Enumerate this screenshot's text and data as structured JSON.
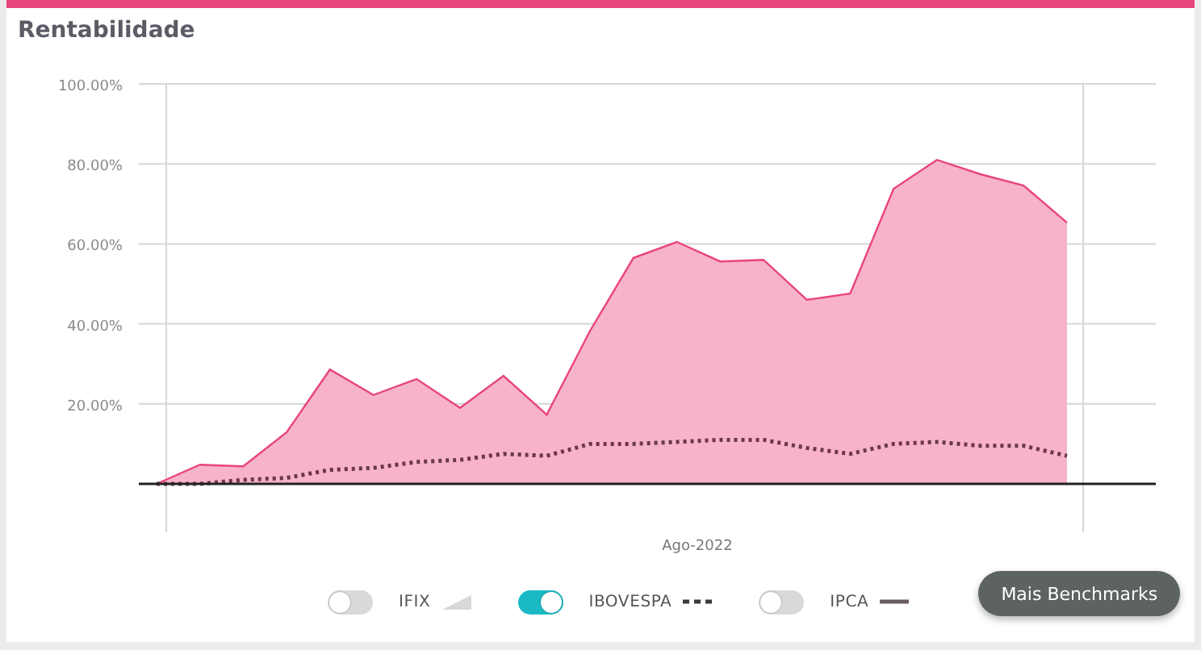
{
  "card": {
    "title": "Rentabilidade"
  },
  "chart": {
    "chart_data": {
      "type": "area",
      "categories": [
        null,
        null,
        null,
        null,
        null,
        null,
        null,
        null,
        null,
        null,
        null,
        null,
        null,
        null,
        null,
        null,
        null,
        null,
        null,
        null,
        null,
        null
      ],
      "series": [
        {
          "color": "#f7b3cb",
          "values": [
            0,
            4.8,
            4.4,
            12.9,
            28.6,
            22.2,
            26.2,
            19,
            27,
            17.3,
            38.3,
            56.5,
            60.5,
            55.6,
            56,
            46,
            47.6,
            73.8,
            81,
            77.4,
            74.6,
            65.3
          ]
        },
        {
          "type": "line",
          "line_style": "dotted",
          "color": "#6b3848",
          "values": [
            0,
            0,
            1,
            1.5,
            3.5,
            4,
            5.5,
            6,
            7.5,
            7,
            10,
            10,
            10.5,
            11,
            11,
            9,
            7.5,
            10,
            10.5,
            9.5,
            9.5,
            7
          ]
        }
      ],
      "ylim": [
        0,
        100
      ],
      "grid": true,
      "annotations": [
        "Ago-2022"
      ],
      "yticks": [
        {
          "value": 20,
          "label": "20.00%"
        },
        {
          "value": 40,
          "label": "40.00%"
        },
        {
          "value": 60,
          "label": "60.00%"
        },
        {
          "value": 80,
          "label": "80.00%"
        },
        {
          "value": 100,
          "label": "100.00%"
        }
      ]
    }
  },
  "benchmarks": [
    {
      "label": "IFIX",
      "on": false,
      "kind": "area"
    },
    {
      "label": "IBOVESPA",
      "on": true,
      "kind": "dashed"
    },
    {
      "label": "IPCA",
      "on": false,
      "kind": "line"
    }
  ],
  "more_button": "Mais Benchmarks"
}
